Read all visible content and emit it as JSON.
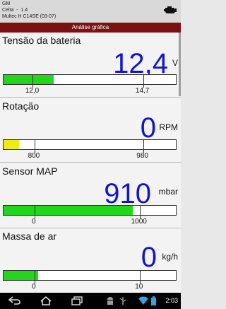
{
  "header": {
    "make": "GM",
    "model": "Celta  -  1.4",
    "ecu": "Multec H C14SE (03-07)",
    "icon": "engine-check-icon"
  },
  "title": "Análise gráfica",
  "gauges": [
    {
      "label": "Tensão da bateria",
      "value": "12,4",
      "unit": "V",
      "fill_fraction": 0.29,
      "fill_color": "#22d61c",
      "ticks": [
        {
          "label": "12,0",
          "frac": 0.17
        },
        {
          "label": "14,7",
          "frac": 0.81
        }
      ]
    },
    {
      "label": "Rotação",
      "value": "0",
      "unit": "RPM",
      "fill_fraction": 0.09,
      "fill_color": "#f2ea14",
      "ticks": [
        {
          "label": "800",
          "frac": 0.18
        },
        {
          "label": "980",
          "frac": 0.81
        }
      ]
    },
    {
      "label": "Sensor MAP",
      "value": "910",
      "unit": "mbar",
      "fill_fraction": 0.75,
      "fill_color": "#22d61c",
      "ticks": [
        {
          "label": "0",
          "frac": 0.18
        },
        {
          "label": "1000",
          "frac": 0.79
        }
      ]
    },
    {
      "label": "Massa de ar",
      "value": "0",
      "unit": "kg/h",
      "fill_fraction": 0.2,
      "fill_color": "#22d61c",
      "ticks": [
        {
          "label": "0",
          "frac": 0.18
        },
        {
          "label": "10",
          "frac": 0.79
        }
      ]
    }
  ],
  "navbar": {
    "icons": [
      "back-icon",
      "home-icon",
      "recent-apps-icon",
      "android-icon",
      "usb-icon",
      "wifi-icon",
      "battery-icon"
    ],
    "clock": "2:03"
  }
}
